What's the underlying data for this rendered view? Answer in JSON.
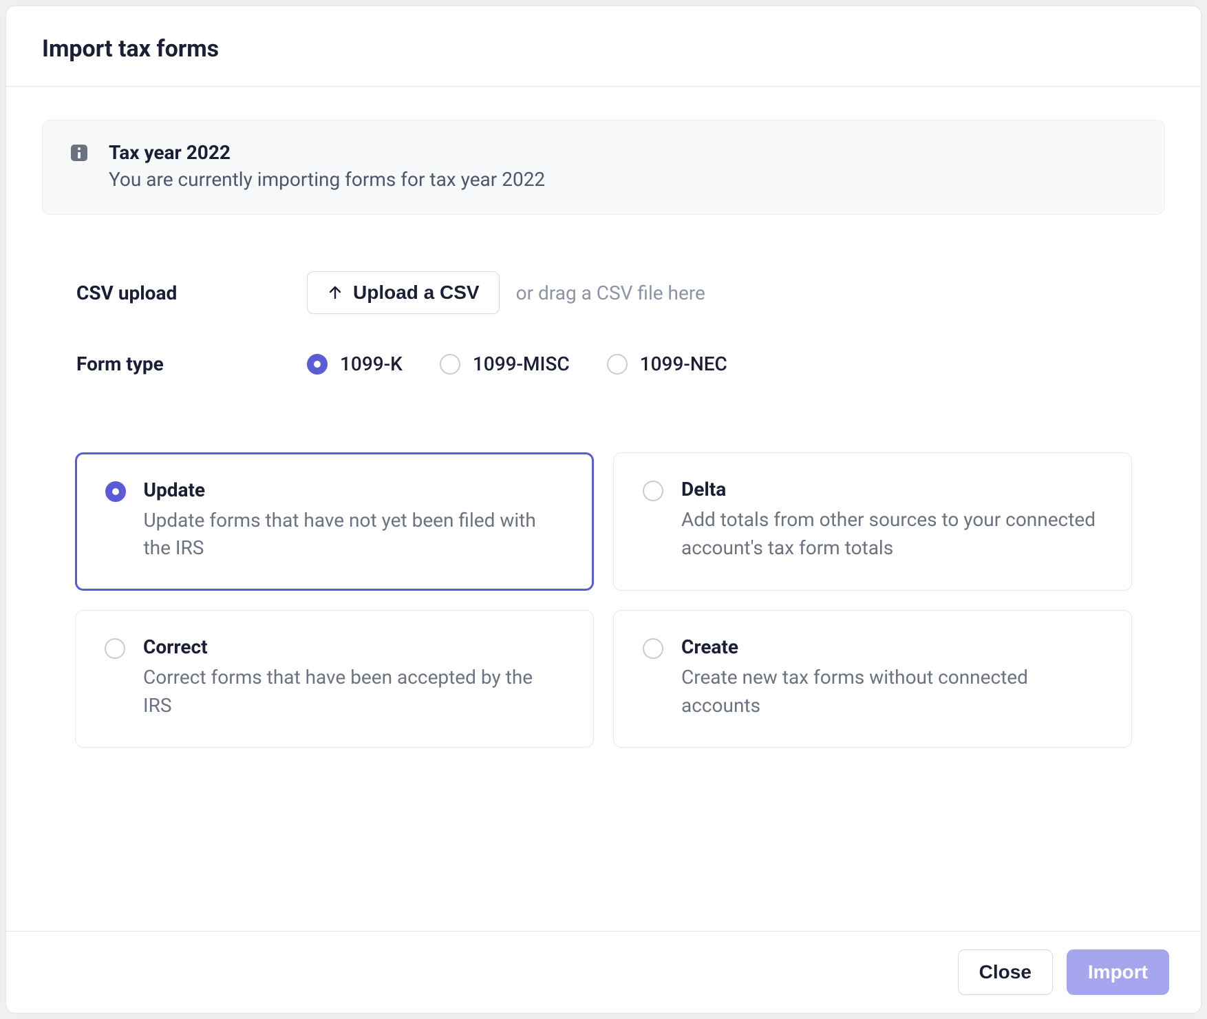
{
  "modal": {
    "title": "Import tax forms"
  },
  "banner": {
    "title": "Tax year 2022",
    "description": "You are currently importing forms for tax year 2022"
  },
  "csv": {
    "label": "CSV upload",
    "button": "Upload a CSV",
    "hint": "or drag a CSV file here"
  },
  "formType": {
    "label": "Form type",
    "options": [
      {
        "value": "1099-K",
        "selected": true
      },
      {
        "value": "1099-MISC",
        "selected": false
      },
      {
        "value": "1099-NEC",
        "selected": false
      }
    ]
  },
  "actions": [
    {
      "title": "Update",
      "description": "Update forms that have not yet been filed with the IRS",
      "selected": true
    },
    {
      "title": "Delta",
      "description": "Add totals from other sources to your connected account's tax form totals",
      "selected": false
    },
    {
      "title": "Correct",
      "description": "Correct forms that have been accepted by the IRS",
      "selected": false
    },
    {
      "title": "Create",
      "description": "Create new tax forms without connected accounts",
      "selected": false
    }
  ],
  "footer": {
    "close": "Close",
    "import": "Import"
  }
}
